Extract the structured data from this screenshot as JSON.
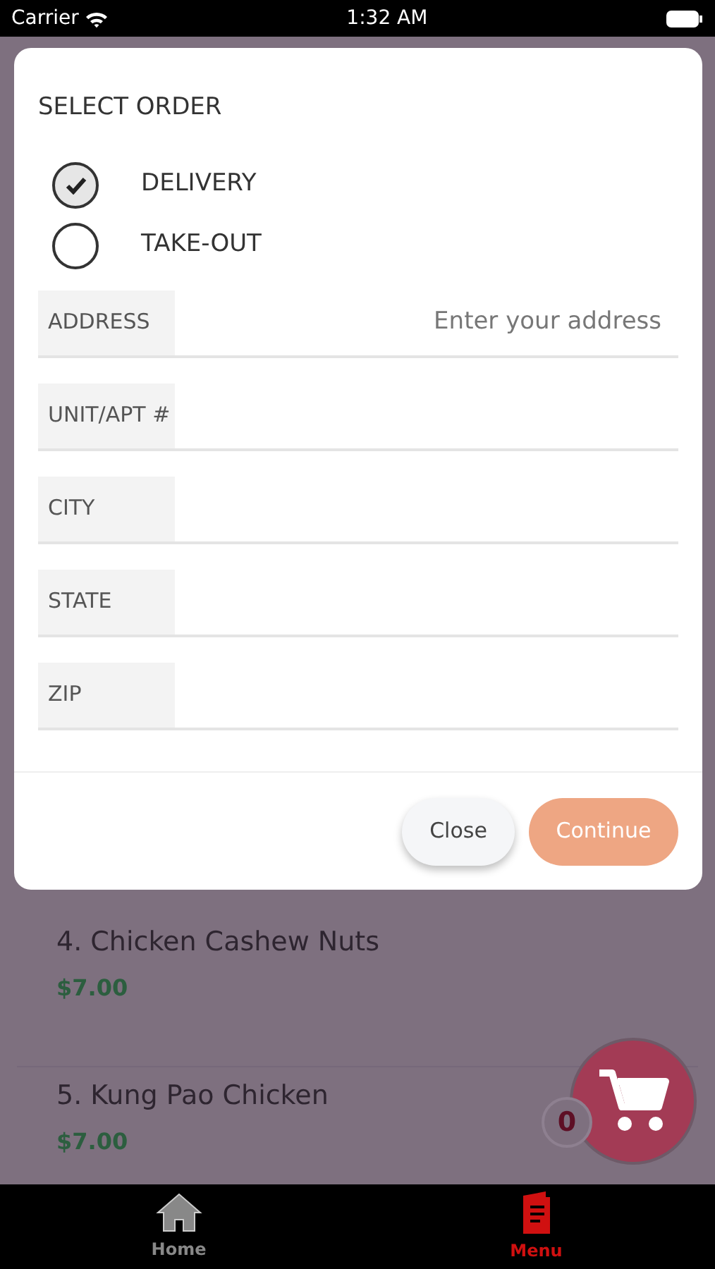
{
  "status_bar": {
    "carrier": "Carrier",
    "time": "1:32 AM"
  },
  "menu_items": [
    {
      "name": "4. Chicken Cashew Nuts",
      "price": "$7.00"
    },
    {
      "name": "5. Kung Pao Chicken",
      "price": "$7.00"
    }
  ],
  "cart": {
    "count": "0"
  },
  "modal": {
    "title": "SELECT ORDER",
    "options": [
      {
        "label": "DELIVERY",
        "selected": true
      },
      {
        "label": "TAKE-OUT",
        "selected": false
      }
    ],
    "fields": [
      {
        "label": "ADDRESS",
        "placeholder": "Enter your address"
      },
      {
        "label": "UNIT/APT #"
      },
      {
        "label": "CITY"
      },
      {
        "label": "STATE"
      },
      {
        "label": "ZIP"
      }
    ],
    "buttons": [
      {
        "label": "Close",
        "kind": "secondary"
      },
      {
        "label": "Continue",
        "kind": "primary"
      }
    ]
  },
  "tab_bar": [
    {
      "label": "Home",
      "kind": "home",
      "selected": false
    },
    {
      "label": "Menu",
      "kind": "menu",
      "selected": true
    }
  ]
}
